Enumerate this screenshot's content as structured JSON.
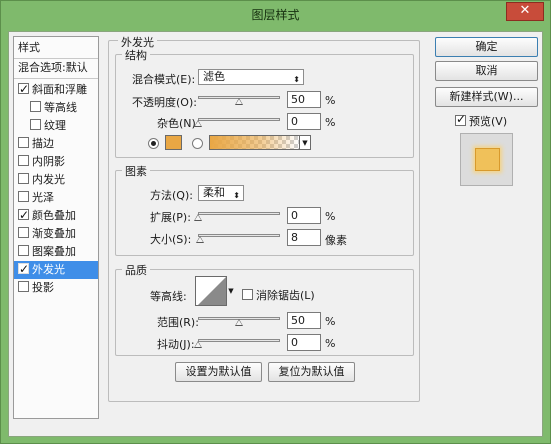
{
  "window": {
    "title": "图层样式",
    "close_icon": "✕"
  },
  "styles_list": {
    "header": "样式",
    "blend_default": "混合选项:默认",
    "items": [
      {
        "label": "斜面和浮雕",
        "checked": true
      },
      {
        "label": "等高线",
        "checked": false
      },
      {
        "label": "纹理",
        "checked": false
      },
      {
        "label": "描边",
        "checked": false
      },
      {
        "label": "内阴影",
        "checked": false
      },
      {
        "label": "内发光",
        "checked": false
      },
      {
        "label": "光泽",
        "checked": false
      },
      {
        "label": "颜色叠加",
        "checked": true
      },
      {
        "label": "渐变叠加",
        "checked": false
      },
      {
        "label": "图案叠加",
        "checked": false
      },
      {
        "label": "外发光",
        "checked": true,
        "selected": true
      },
      {
        "label": "投影",
        "checked": false
      }
    ]
  },
  "outer_glow": {
    "title": "外发光",
    "structure": {
      "title": "结构",
      "blend_mode_label": "混合模式(E):",
      "blend_mode_value": "滤色",
      "opacity_label": "不透明度(O):",
      "opacity_value": "50",
      "opacity_fraction": 0.5,
      "noise_label": "杂色(N):",
      "noise_value": "0",
      "noise_fraction": 0.0,
      "percent": "%",
      "color_swatch": "#e9a744",
      "color_mode": "solid"
    },
    "elements": {
      "title": "图素",
      "technique_label": "方法(Q):",
      "technique_value": "柔和",
      "spread_label": "扩展(P):",
      "spread_value": "0",
      "spread_fraction": 0.0,
      "size_label": "大小(S):",
      "size_value": "8",
      "size_fraction": 0.03,
      "percent": "%",
      "pixels": "像素"
    },
    "quality": {
      "title": "品质",
      "contour_label": "等高线:",
      "anti_alias_label": "消除锯齿(L)",
      "anti_alias_checked": false,
      "range_label": "范围(R):",
      "range_value": "50",
      "range_fraction": 0.5,
      "jitter_label": "抖动(J):",
      "jitter_value": "0",
      "jitter_fraction": 0.0,
      "percent": "%"
    },
    "make_default": "设置为默认值",
    "reset_default": "复位为默认值"
  },
  "buttons": {
    "ok": "确定",
    "cancel": "取消",
    "new_style": "新建样式(W)...",
    "preview_label": "预览(V)",
    "preview_checked": true
  },
  "colors": {
    "glow": "#e9a744",
    "selection": "#3f8ee8",
    "title_bar": "#7fba6c"
  }
}
